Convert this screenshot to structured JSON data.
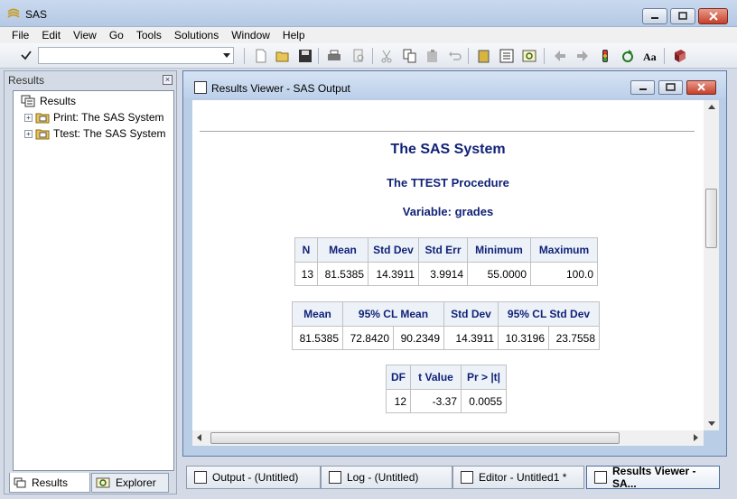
{
  "app": {
    "title": "SAS"
  },
  "menu": [
    "File",
    "Edit",
    "View",
    "Go",
    "Tools",
    "Solutions",
    "Window",
    "Help"
  ],
  "command_bar": {
    "value": "",
    "placeholder": ""
  },
  "results_pane": {
    "header": "Results",
    "tree": {
      "root": "Results",
      "children": [
        "Print:  The SAS System",
        "Ttest:  The SAS System"
      ]
    },
    "tabs": [
      "Results",
      "Explorer"
    ]
  },
  "viewer": {
    "title": "Results Viewer - SAS Output",
    "output": {
      "system_title": "The SAS System",
      "procedure_title": "The TTEST Procedure",
      "variable_title": "Variable: grades",
      "table1": {
        "headers": [
          "N",
          "Mean",
          "Std Dev",
          "Std Err",
          "Minimum",
          "Maximum"
        ],
        "rows": [
          [
            "13",
            "81.5385",
            "14.3911",
            "3.9914",
            "55.0000",
            "100.0"
          ]
        ]
      },
      "table2": {
        "headers": [
          "Mean",
          "95% CL Mean",
          "Std Dev",
          "95% CL Std Dev"
        ],
        "rows": [
          [
            "81.5385",
            "72.8420",
            "90.2349",
            "14.3911",
            "10.3196",
            "23.7558"
          ]
        ]
      },
      "table3": {
        "headers": [
          "DF",
          "t Value",
          "Pr > |t|"
        ],
        "rows": [
          [
            "12",
            "-3.37",
            "0.0055"
          ]
        ]
      }
    }
  },
  "window_tabs": [
    "Output - (Untitled)",
    "Log - (Untitled)",
    "Editor - Untitled1 *",
    "Results Viewer - SA..."
  ],
  "colors": {
    "header_text": "#112277",
    "header_bg": "#edf2f9",
    "close_red": "#c6402a"
  }
}
